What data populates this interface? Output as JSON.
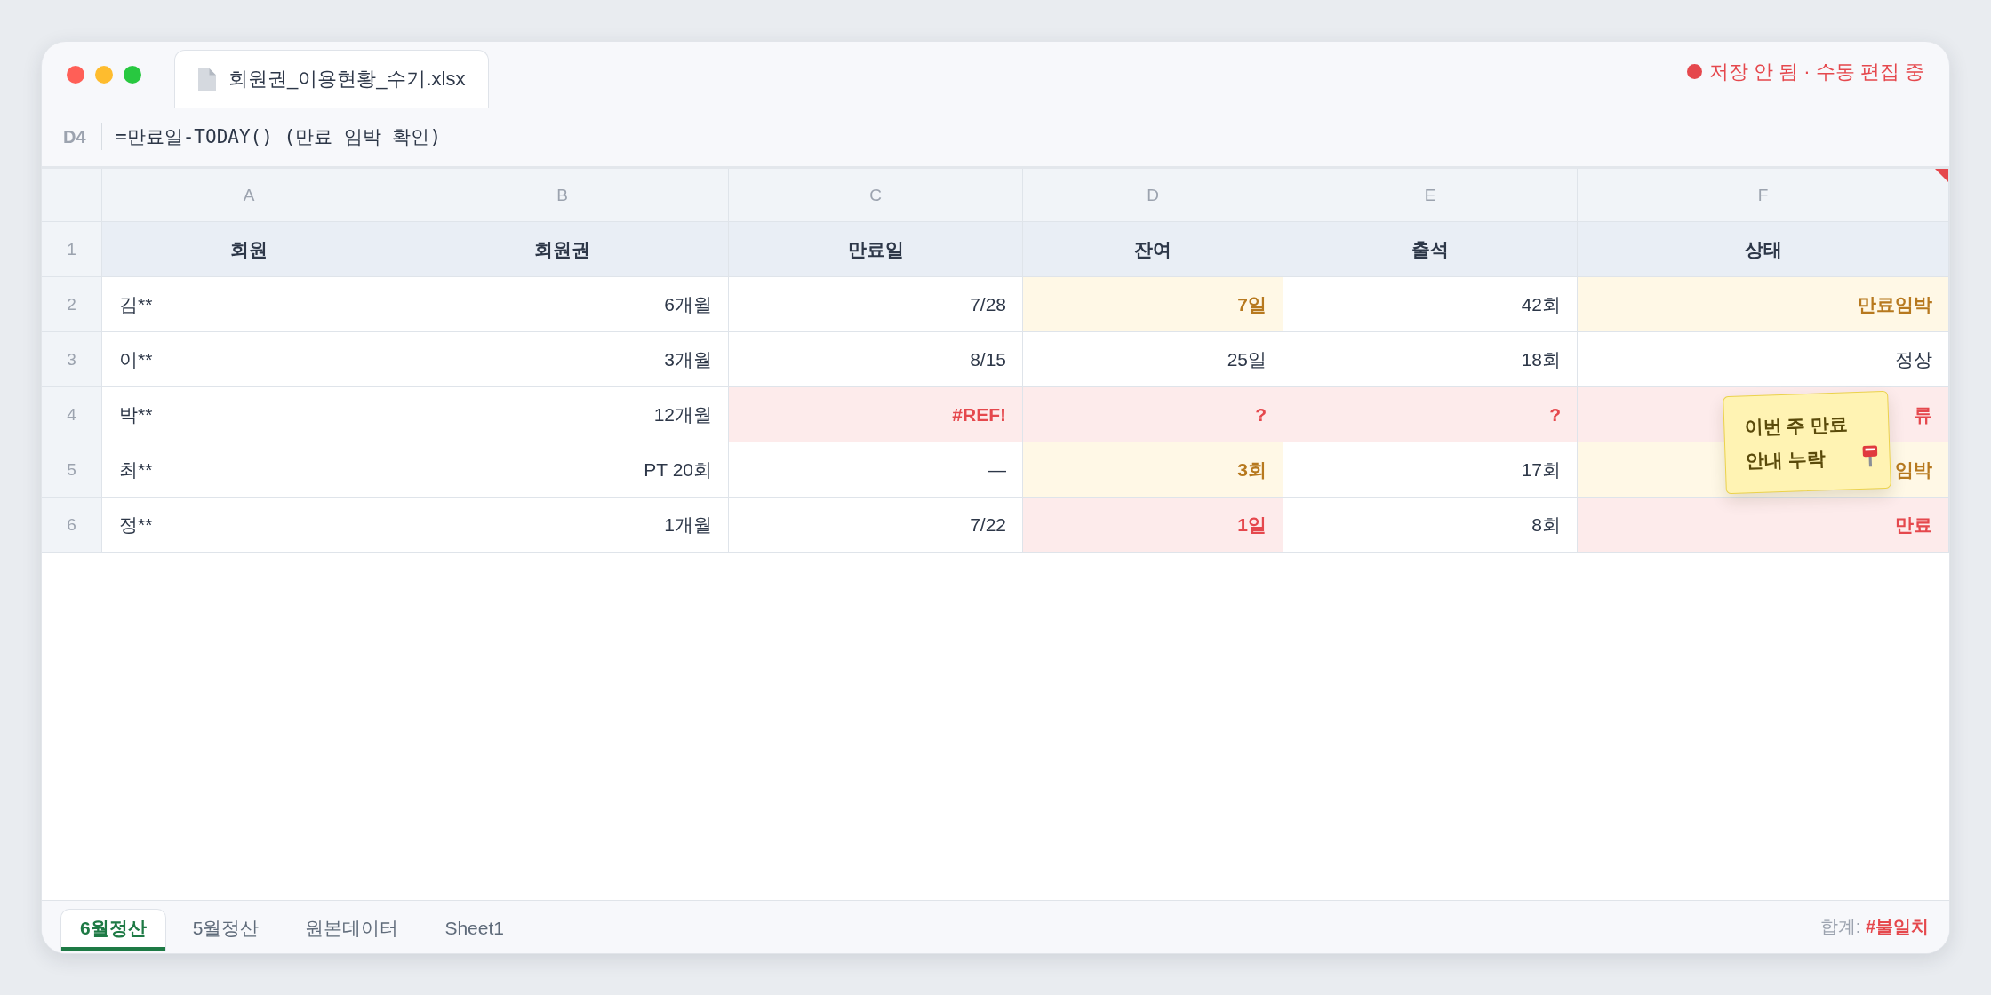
{
  "window": {
    "title": "회원권_이용현황_수기.xlsx",
    "status": "저장 안 됨 · 수동 편집 중"
  },
  "formula_bar": {
    "cell": "D4",
    "formula": "=만료일-TODAY() (만료 임박 확인)"
  },
  "table": {
    "columns": [
      {
        "label": "A",
        "flagged": false
      },
      {
        "label": "B",
        "flagged": false
      },
      {
        "label": "C",
        "flagged": false
      },
      {
        "label": "D",
        "flagged": false
      },
      {
        "label": "E",
        "flagged": false
      },
      {
        "label": "F",
        "flagged": true
      }
    ],
    "header_row": {
      "number": "1",
      "cells": [
        "회원",
        "회원권",
        "만료일",
        "잔여",
        "출석",
        "상태"
      ]
    },
    "rows": [
      {
        "number": "2",
        "cells": [
          {
            "text": "김**",
            "kind": "plain"
          },
          {
            "text": "6개월",
            "kind": "plain"
          },
          {
            "text": "7/28",
            "kind": "plain"
          },
          {
            "text": "7일",
            "kind": "warning"
          },
          {
            "text": "42회",
            "kind": "plain"
          },
          {
            "text": "만료임박",
            "kind": "warning"
          }
        ]
      },
      {
        "number": "3",
        "cells": [
          {
            "text": "이**",
            "kind": "plain"
          },
          {
            "text": "3개월",
            "kind": "plain"
          },
          {
            "text": "8/15",
            "kind": "plain"
          },
          {
            "text": "25일",
            "kind": "plain"
          },
          {
            "text": "18회",
            "kind": "plain"
          },
          {
            "text": "정상",
            "kind": "plain"
          }
        ]
      },
      {
        "number": "4",
        "cells": [
          {
            "text": "박**",
            "kind": "plain"
          },
          {
            "text": "12개월",
            "kind": "plain"
          },
          {
            "text": "#REF!",
            "kind": "error"
          },
          {
            "text": "?",
            "kind": "error"
          },
          {
            "text": "?",
            "kind": "error"
          },
          {
            "text": "류",
            "kind": "error"
          }
        ]
      },
      {
        "number": "5",
        "cells": [
          {
            "text": "최**",
            "kind": "plain"
          },
          {
            "text": "PT 20회",
            "kind": "plain"
          },
          {
            "text": "—",
            "kind": "plain"
          },
          {
            "text": "3회",
            "kind": "warning"
          },
          {
            "text": "17회",
            "kind": "plain"
          },
          {
            "text": "임박",
            "kind": "warning"
          }
        ]
      },
      {
        "number": "6",
        "cells": [
          {
            "text": "정**",
            "kind": "plain"
          },
          {
            "text": "1개월",
            "kind": "plain"
          },
          {
            "text": "7/22",
            "kind": "plain"
          },
          {
            "text": "1일",
            "kind": "error"
          },
          {
            "text": "8회",
            "kind": "plain"
          },
          {
            "text": "만료",
            "kind": "error"
          }
        ]
      }
    ]
  },
  "sticky_note": {
    "text": "이번 주 만료 안내 누락"
  },
  "sheet_tabs": [
    {
      "label": "6월정산",
      "selected": true
    },
    {
      "label": "5월정산",
      "selected": false
    },
    {
      "label": "원본데이터",
      "selected": false
    },
    {
      "label": "Sheet1",
      "selected": false
    }
  ],
  "status_bar": {
    "total": "합계: **#불일치**"
  }
}
